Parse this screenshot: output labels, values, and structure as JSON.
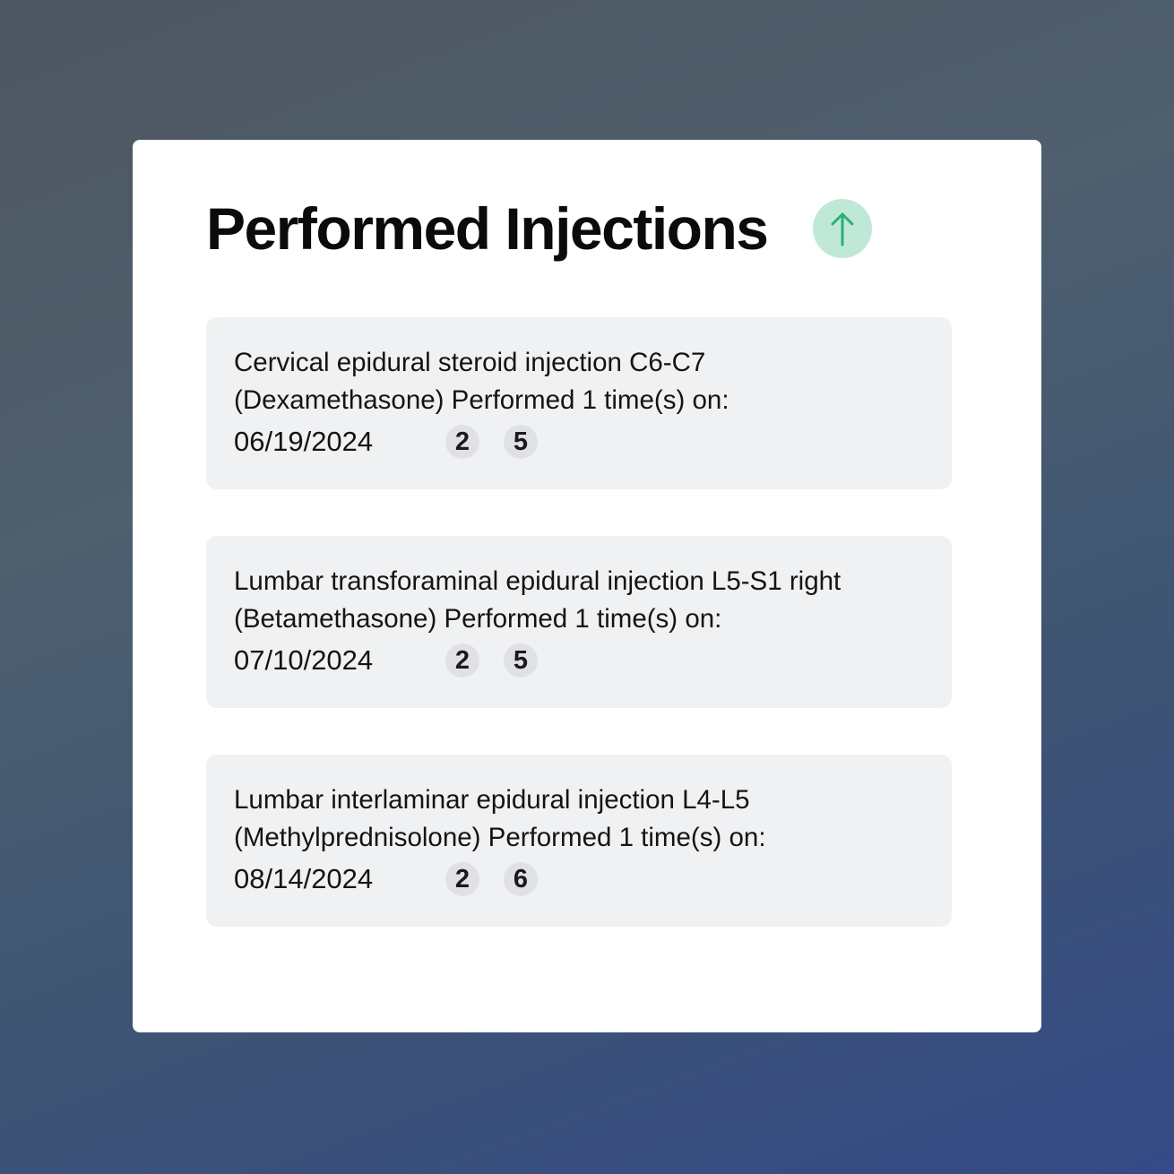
{
  "panel": {
    "title": "Performed Injections",
    "sort_icon": "arrow-up-icon",
    "accent_color": "#2eae74",
    "sort_button_bg": "#bfe8d6"
  },
  "injections": [
    {
      "line1": "Cervical epidural steroid injection C6-C7",
      "line2": "(Dexamethasone) Performed 1 time(s) on:",
      "date": "06/19/2024",
      "badges": [
        "2",
        "5"
      ]
    },
    {
      "line1": "Lumbar transforaminal epidural injection L5-S1 right",
      "line2": "(Betamethasone) Performed 1 time(s) on:",
      "date": "07/10/2024",
      "badges": [
        "2",
        "5"
      ]
    },
    {
      "line1": "Lumbar interlaminar epidural injection L4-L5",
      "line2": "(Methylprednisolone) Performed 1 time(s) on:",
      "date": "08/14/2024",
      "badges": [
        "2",
        "6"
      ]
    }
  ]
}
